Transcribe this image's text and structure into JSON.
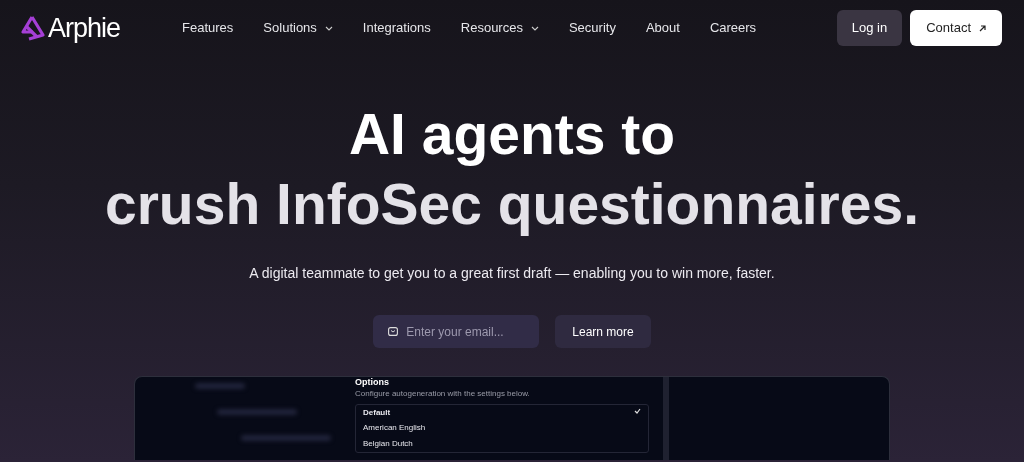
{
  "brand": {
    "name": "Arphie"
  },
  "nav": [
    {
      "label": "Features",
      "dropdown": false
    },
    {
      "label": "Solutions",
      "dropdown": true
    },
    {
      "label": "Integrations",
      "dropdown": false
    },
    {
      "label": "Resources",
      "dropdown": true
    },
    {
      "label": "Security",
      "dropdown": false
    },
    {
      "label": "About",
      "dropdown": false
    },
    {
      "label": "Careers",
      "dropdown": false
    }
  ],
  "actions": {
    "login": "Log in",
    "contact": "Contact"
  },
  "hero": {
    "title_lines": [
      "AI agents to",
      "crush InfoSec questionnaires."
    ],
    "subtitle": "A digital teammate to get you to a great first draft — enabling you to win more, faster.",
    "email": {
      "placeholder": "Enter your email..."
    },
    "button": "Learn more"
  },
  "preview": {
    "title": "Options",
    "description": "Configure autogeneration with the settings below.",
    "options": [
      {
        "label": "Default",
        "selected": true
      },
      {
        "label": "American English",
        "selected": false
      },
      {
        "label": "Belgian Dutch",
        "selected": false
      }
    ]
  }
}
